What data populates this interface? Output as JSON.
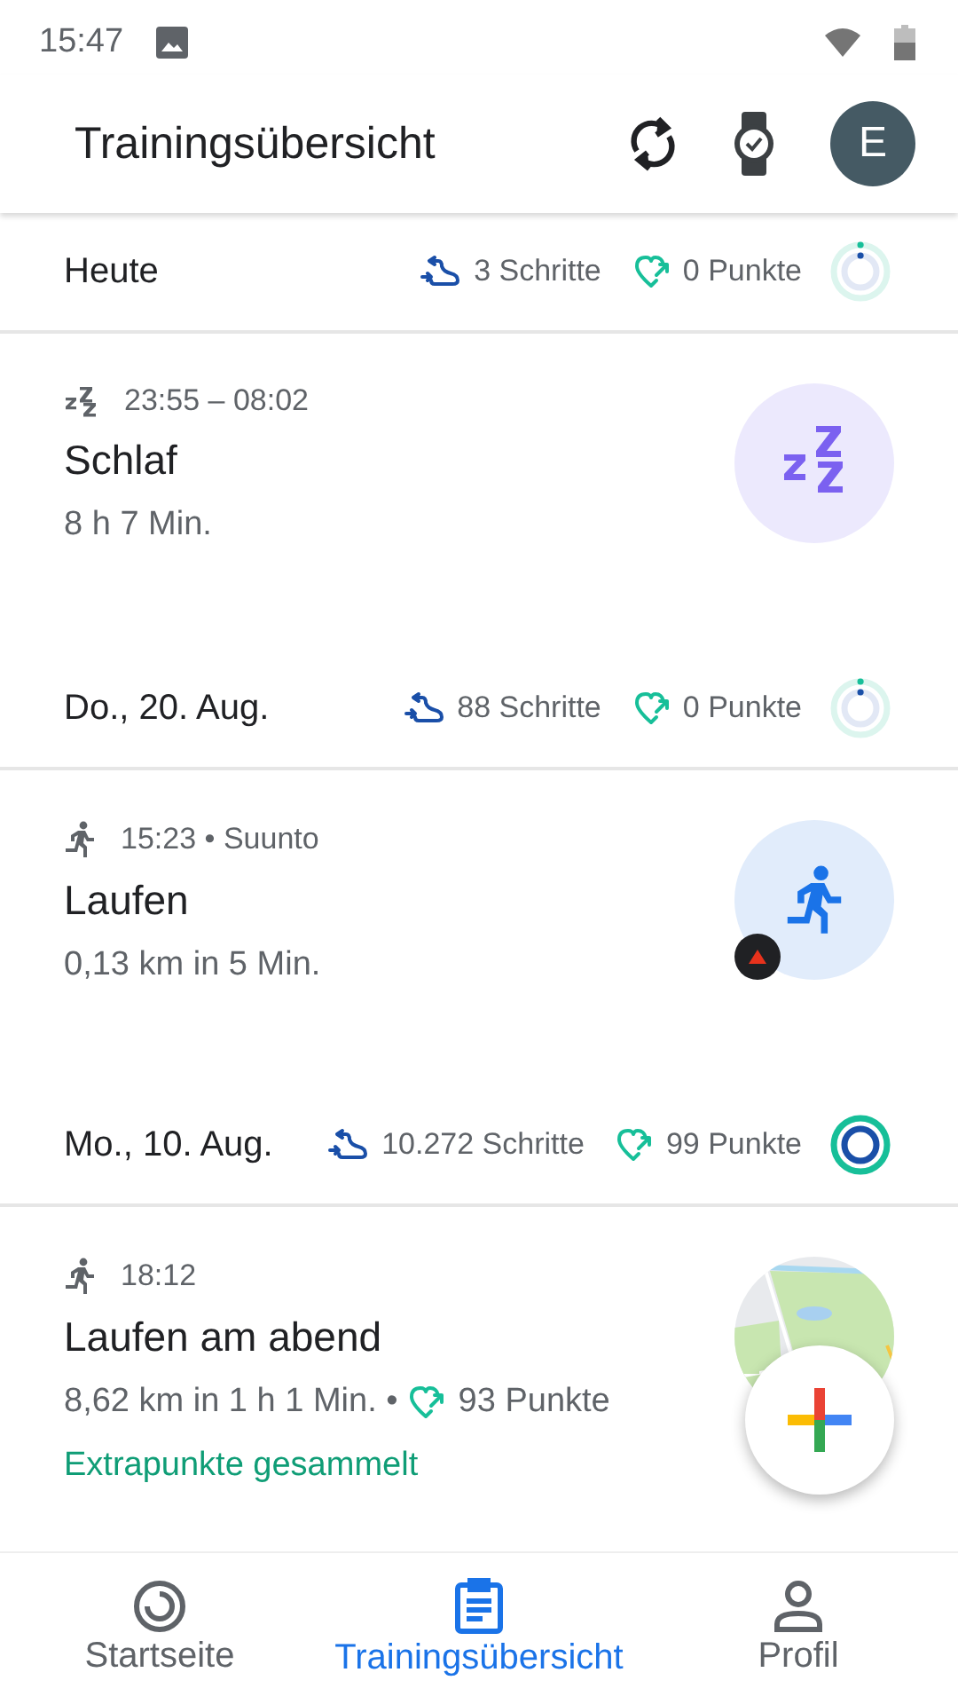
{
  "status_bar": {
    "time": "15:47"
  },
  "app_bar": {
    "title": "Trainingsübersicht",
    "avatar": "E"
  },
  "feed": [
    {
      "kind": "day",
      "date": "Heute",
      "steps": "3 Schritte",
      "points": "0 Punkte",
      "goal_met": false
    },
    {
      "kind": "activity",
      "icon": {
        "kind": "sleep"
      },
      "time": "23:55 – 08:02",
      "title": "Schlaf",
      "summary": "8 h 7 Min.",
      "thumbnail": {
        "kind": "sleep"
      },
      "source_badge": false
    },
    {
      "kind": "day",
      "date": "Do., 20. Aug.",
      "steps": "88 Schritte",
      "points": "0 Punkte",
      "goal_met": false
    },
    {
      "kind": "activity",
      "icon": {
        "kind": "run"
      },
      "time": "15:23 • Suunto",
      "title": "Laufen",
      "summary": "0,13 km in 5 Min.",
      "thumbnail": {
        "kind": "run"
      },
      "source_badge": true
    },
    {
      "kind": "day",
      "date": "Mo., 10. Aug.",
      "steps": "10.272 Schritte",
      "points": "99 Punkte",
      "goal_met": true
    },
    {
      "kind": "activity",
      "icon": {
        "kind": "run"
      },
      "time": "18:12",
      "title": "Laufen am abend",
      "summary": "8,62 km in 1 h 1 Min. •",
      "points": "93 Punkte",
      "note": "Extrapunkte gesammelt",
      "source_badge": false
    }
  ],
  "nav": [
    {
      "kind": "home",
      "label": "Startseite",
      "selected": false
    },
    {
      "kind": "journal",
      "label": "Trainingsübersicht",
      "selected": true
    },
    {
      "kind": "profile",
      "label": "Profil",
      "selected": false
    }
  ]
}
